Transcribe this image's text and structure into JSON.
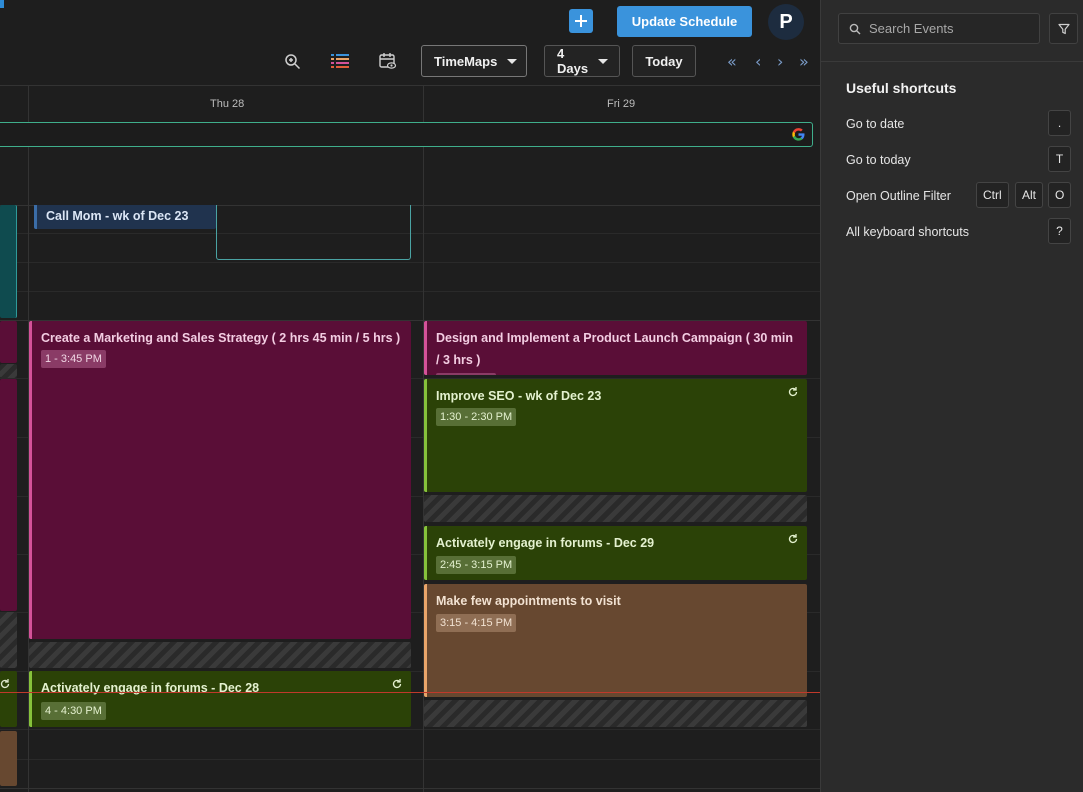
{
  "header": {
    "add_icon": "plus-icon",
    "update_label": "Update Schedule",
    "avatar_initial": "P"
  },
  "toolbar": {
    "zoom_icon": "zoom-in-icon",
    "outline_icon": "color-list-icon",
    "calendar_view_icon": "calendar-eye-icon",
    "view_mode": "TimeMaps",
    "day_range": "4 Days",
    "today_label": "Today",
    "nav": {
      "first": "«",
      "prev": "‹",
      "next": "›",
      "last": "»"
    }
  },
  "days": [
    {
      "label": "Thu 28"
    },
    {
      "label": "Fri 29"
    }
  ],
  "events": {
    "call_mom": {
      "title": "Call Mom - wk of Dec 23"
    },
    "marketing": {
      "title": "Create a Marketing and Sales Strategy ( 2 hrs 45 min / 5 hrs )",
      "time": "1 - 3:45 PM"
    },
    "forums_28": {
      "title": "Activately engage in forums - Dec 28",
      "time": "4 - 4:30 PM"
    },
    "launch": {
      "title": "Design and Implement a Product Launch Campaign ( 30 min / 3 hrs )"
    },
    "seo": {
      "title": "Improve SEO - wk of Dec 23",
      "time": "1:30 - 2:30 PM"
    },
    "forums_29": {
      "title": "Activately engage in forums - Dec 29",
      "time": "2:45 - 3:15 PM"
    },
    "appointments": {
      "title": "Make few appointments to visit",
      "time": "3:15 - 4:15 PM"
    }
  },
  "sidebar": {
    "search_placeholder": "Search Events",
    "shortcuts_title": "Useful shortcuts",
    "shortcuts": [
      {
        "label": "Go to date",
        "keys": [
          "."
        ]
      },
      {
        "label": "Go to today",
        "keys": [
          "T"
        ]
      },
      {
        "label": "Open Outline Filter",
        "keys": [
          "Ctrl",
          "Alt",
          "O"
        ]
      },
      {
        "label": "All keyboard shortcuts",
        "keys": [
          "?"
        ]
      }
    ]
  },
  "colors": {
    "accent": "#3a93dc",
    "pink_event": "#5a0e37",
    "green_event": "#2b4207",
    "brown_event": "#674830",
    "navy_event": "#20334e",
    "now_line": "#c0392b"
  }
}
